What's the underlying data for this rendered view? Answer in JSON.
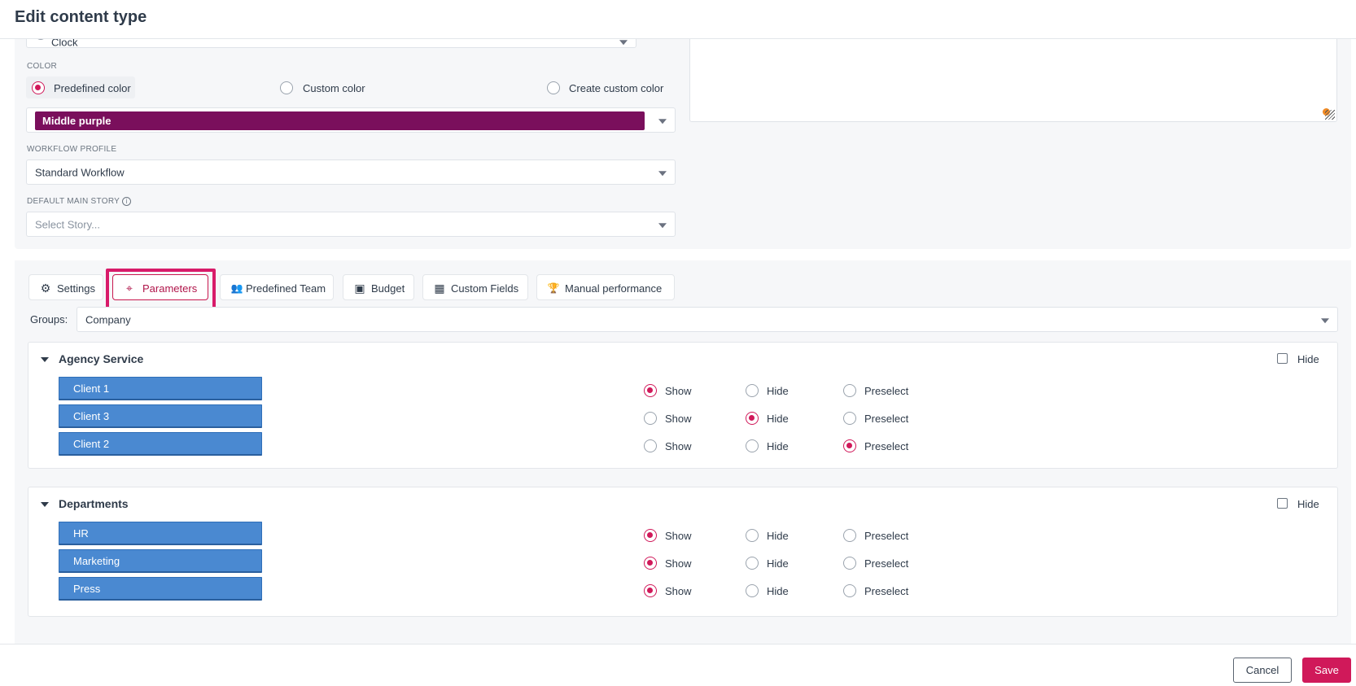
{
  "header": {
    "title": "Edit content type"
  },
  "settings": {
    "icon_field": {
      "value": "Clock"
    },
    "color": {
      "label": "COLOR",
      "options": [
        "Predefined color",
        "Custom color",
        "Create custom color"
      ],
      "selected": "Predefined color",
      "selected_color_name": "Middle purple",
      "selected_color_hex": "#7a0f5c"
    },
    "workflow": {
      "label": "WORKFLOW PROFILE",
      "value": "Standard Workflow"
    },
    "main_story": {
      "label": "DEFAULT MAIN STORY",
      "info_icon": "i",
      "placeholder": "Select Story..."
    }
  },
  "tabs": [
    {
      "label": "Settings",
      "icon": "gear-icon",
      "glyph": "⚙"
    },
    {
      "label": "Parameters",
      "icon": "crosshair-icon",
      "glyph": "⌖",
      "active": true
    },
    {
      "label": "Predefined Team",
      "icon": "users-icon",
      "glyph": "👥"
    },
    {
      "label": "Budget",
      "icon": "wallet-icon",
      "glyph": "▣"
    },
    {
      "label": "Custom Fields",
      "icon": "grid-icon",
      "glyph": "▦"
    },
    {
      "label": "Manual performance",
      "icon": "trophy-icon",
      "glyph": "🏆"
    }
  ],
  "groups_selector": {
    "label": "Groups:",
    "value": "Company"
  },
  "option_labels": [
    "Show",
    "Hide",
    "Preselect"
  ],
  "groups": [
    {
      "title": "Agency Service",
      "hide_label": "Hide",
      "items": [
        {
          "name": "Client 1",
          "state": "Show"
        },
        {
          "name": "Client 3",
          "state": "Hide"
        },
        {
          "name": "Client 2",
          "state": "Preselect"
        }
      ]
    },
    {
      "title": "Departments",
      "hide_label": "Hide",
      "items": [
        {
          "name": "HR",
          "state": "Show"
        },
        {
          "name": "Marketing",
          "state": "Show"
        },
        {
          "name": "Press",
          "state": "Show"
        }
      ]
    }
  ],
  "footer": {
    "cancel_label": "Cancel",
    "save_label": "Save"
  },
  "colors": {
    "accent": "#d0195a",
    "pill": "#4a89d1"
  }
}
